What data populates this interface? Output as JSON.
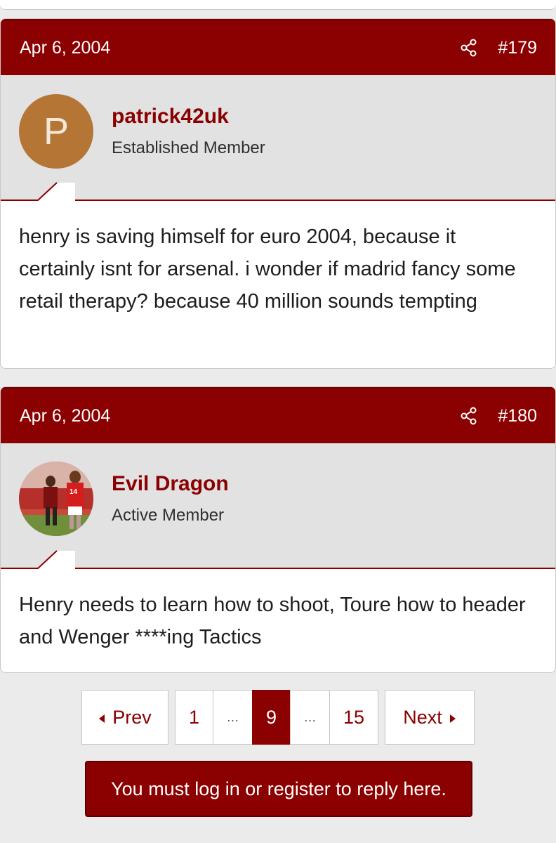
{
  "posts": [
    {
      "date": "Apr 6, 2004",
      "number": "#179",
      "avatar_letter": "P",
      "avatar_color": "#b57535",
      "username": "patrick42uk",
      "user_title": "Established Member",
      "body": "henry is saving himself for euro 2004, because it certainly isnt for arsenal. i wonder if madrid fancy some retail therapy? because 40 million sounds tempting"
    },
    {
      "date": "Apr 6, 2004",
      "number": "#180",
      "avatar_type": "photo",
      "username": "Evil Dragon",
      "user_title": "Active Member",
      "body": "Henry needs to learn how to shoot, Toure how to header and Wenger ****ing Tactics"
    }
  ],
  "pagination": {
    "prev": "Prev",
    "next": "Next",
    "pages": [
      "1",
      "…",
      "9",
      "…",
      "15"
    ],
    "current": "9"
  },
  "reply_prompt": "You must log in or register to reply here.",
  "colors": {
    "accent": "#8b0000",
    "background": "#ebebeb",
    "user_block": "#e2e2e2"
  },
  "icons": [
    "share-icon",
    "chevron-left-icon",
    "chevron-right-icon"
  ]
}
